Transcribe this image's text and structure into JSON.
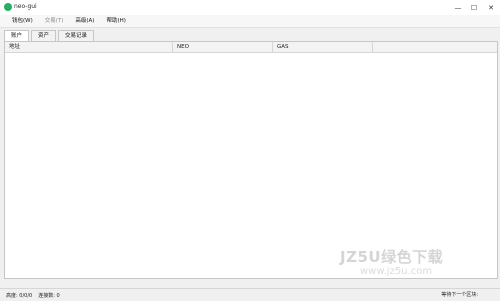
{
  "window": {
    "title": "neo-gui",
    "controls": {
      "minimize": "—",
      "maximize": "☐",
      "close": "✕"
    }
  },
  "menu": [
    {
      "label": "钱包(W)",
      "disabled": false
    },
    {
      "label": "交易(T)",
      "disabled": true
    },
    {
      "label": "高级(A)",
      "disabled": false
    },
    {
      "label": "帮助(H)",
      "disabled": false
    }
  ],
  "tabs": [
    {
      "label": "账户",
      "active": true
    },
    {
      "label": "资产",
      "active": false
    },
    {
      "label": "交易记录",
      "active": false
    }
  ],
  "table": {
    "columns": [
      {
        "label": "地址"
      },
      {
        "label": "NEO"
      },
      {
        "label": "GAS"
      }
    ],
    "rows": []
  },
  "status": {
    "height_label": "高度: 0/0/0",
    "connections_label": "连接数: 0",
    "next_block_label": "等待下一个区块:"
  },
  "watermark": {
    "main": "JZ5U绿色下载",
    "sub": "www.jz5u.com"
  }
}
